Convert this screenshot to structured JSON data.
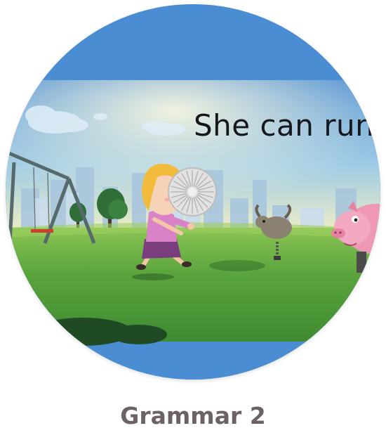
{
  "card": {
    "title": "Grammar 2",
    "video_caption": "She can run"
  },
  "thumbnail": {
    "icon": "loading-spinner-icon",
    "colors": {
      "sky": "#4a8dd3",
      "grass": "#4d9a3a",
      "title_text": "#6b6166"
    }
  }
}
